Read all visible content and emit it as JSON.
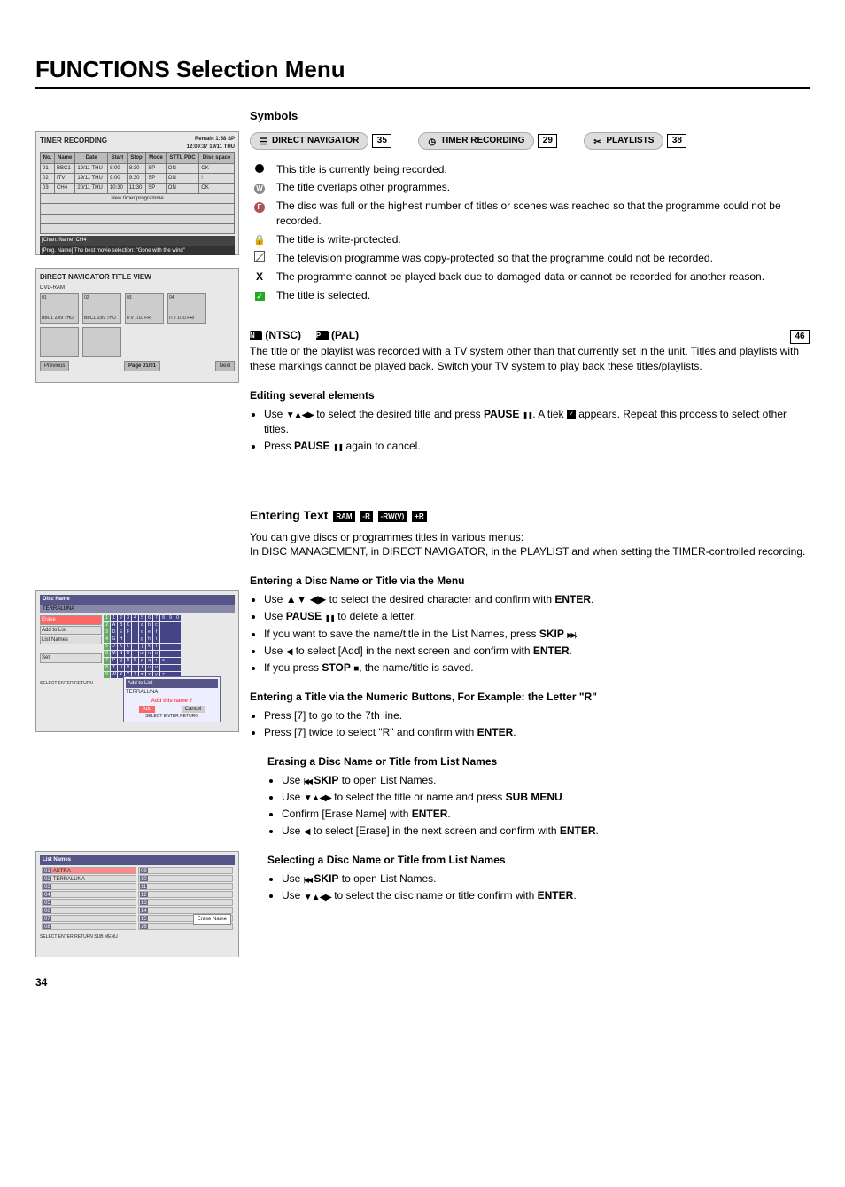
{
  "page": {
    "title": "FUNCTIONS Selection Menu",
    "number": "34"
  },
  "nav": {
    "symbols_heading": "Symbols",
    "items": [
      {
        "label": "DIRECT NAVIGATOR",
        "page": "35"
      },
      {
        "label": "TIMER RECORDING",
        "page": "29"
      },
      {
        "label": "PLAYLISTS",
        "page": "38"
      }
    ]
  },
  "symbols": [
    {
      "text": "This title is currently being recorded."
    },
    {
      "text": "The title overlaps other programmes."
    },
    {
      "text": "The disc was full or the highest number of titles or scenes was reached so that the programme could not be recorded."
    },
    {
      "text": "The title is write-protected."
    },
    {
      "text": "The television programme was copy-protected so that the programme could not be recorded."
    },
    {
      "text": "The programme cannot be played back due to damaged data or cannot be recorded for another reason.",
      "prefix": "X"
    },
    {
      "text": "The title is selected."
    }
  ],
  "ntsc_pal": {
    "ntsc": "(NTSC)",
    "pal": "(PAL)",
    "page": "46",
    "body": "The title or the playlist was recorded with a TV system other than that currently set in the unit. Titles and playlists with these markings cannot be played back. Switch your TV system to play back these titles/playlists."
  },
  "editing": {
    "heading": "Editing several elements",
    "b1a": "Use ",
    "b1b": " to select the desired title and press ",
    "b1c": "PAUSE",
    "b1d": ". A tiek ",
    "b1e": " appears. Repeat this process to select other titles.",
    "b2a": "Press ",
    "b2b": "PAUSE",
    "b2c": " again to cancel."
  },
  "entering": {
    "heading": "Entering Text",
    "badges": [
      "RAM",
      "-R",
      "-RW(V)",
      "+R"
    ],
    "intro1": "You can give discs or programmes titles in various menus:",
    "intro2": "In DISC MANAGEMENT, in DIRECT NAVIGATOR, in the PLAYLIST and when setting the TIMER-controlled recording."
  },
  "via_menu": {
    "heading": "Entering a Disc Name or Title via the Menu",
    "l1a": "Use ",
    "l1b": " to select the desired character and confirm with ",
    "l1c": "ENTER",
    "l1d": ".",
    "l2a": "Use ",
    "l2b": "PAUSE",
    "l2c": " to delete a letter.",
    "l3a": "If you want to save the name/title in the List Names, press ",
    "l3b": "SKIP",
    "l3c": ".",
    "l4a": "Use ",
    "l4b": " to select [Add] in the next screen and confirm with ",
    "l4c": "ENTER",
    "l4d": ".",
    "l5a": "If you press ",
    "l5b": "STOP",
    "l5c": ", the name/title is saved."
  },
  "via_numeric": {
    "heading": "Entering a Title via the Numeric Buttons, For Example: the Letter \"R\"",
    "l1": "Press [7] to go to the 7th line.",
    "l2a": "Press [7] twice to select \"R\" and confirm with ",
    "l2b": "ENTER",
    "l2c": "."
  },
  "erasing": {
    "heading": "Erasing a Disc Name or Title from List Names",
    "l1a": "Use ",
    "l1b": "SKIP",
    "l1c": " to open List Names.",
    "l2a": "Use ",
    "l2b": " to select the title or name and press ",
    "l2c": "SUB MENU",
    "l2d": ".",
    "l3a": "Confirm [Erase Name] with ",
    "l3b": "ENTER",
    "l3c": ".",
    "l4a": "Use ",
    "l4b": " to select [Erase] in the next screen and confirm with ",
    "l4c": "ENTER",
    "l4d": "."
  },
  "selecting": {
    "heading": "Selecting a Disc Name or Title from List Names",
    "l1a": "Use ",
    "l1b": "SKIP",
    "l1c": " to open List Names.",
    "l2a": "Use ",
    "l2b": " to select the disc name or title confirm with ",
    "l2c": "ENTER",
    "l2d": "."
  },
  "shots": {
    "timer": {
      "title": "TIMER RECORDING",
      "remain": "Remain   1:58 SP",
      "date": "12:09:37    19/11  THU",
      "cols": [
        "No.",
        "Name",
        "Date",
        "Start",
        "Stop",
        "Mode",
        "STTL PDC",
        "Disc space"
      ],
      "rows": [
        [
          "01",
          "BBC1",
          "19/11 THU",
          "8:00",
          "8:30",
          "SP",
          "ON",
          "OK"
        ],
        [
          "02",
          "ITV",
          "19/11 THU",
          "9:00",
          "9:30",
          "SP",
          "ON",
          "!"
        ],
        [
          "03",
          "CH4",
          "20/11 THU",
          "10:30",
          "11:30",
          "SP",
          "ON",
          "OK"
        ]
      ],
      "new": "New timer programme",
      "chan": "[Chan. Name] CH4",
      "prog": "[Prog. Name] The best movie selection: \"Gone with the wind\""
    },
    "titleview": {
      "head": "DIRECT NAVIGATOR  TITLE VIEW",
      "disc": "DVD-RAM",
      "cells": [
        {
          "n": "01",
          "t": "BBC1  23/9 THU"
        },
        {
          "n": "02",
          "t": "BBC1  23/9 THU"
        },
        {
          "n": "03",
          "t": "ITV  1/10 FRI"
        },
        {
          "n": "04",
          "t": "ITV  1/10 FRI"
        }
      ],
      "prev": "Previous",
      "page": "Page 01/01",
      "next": "Next"
    },
    "discname": {
      "head": "Disc Name",
      "val": "TERRALUNA",
      "left": [
        "Erase",
        "Add to List",
        "List Names",
        "Set"
      ],
      "popup_head": "Add to List",
      "popup_val": "TERRALUNA",
      "popup_q": "Add this name ?",
      "popup_add": "Add",
      "popup_cancel": "Cancel",
      "foot": "SELECT   ENTER   RETURN"
    },
    "listnames": {
      "head": "List Names",
      "r1": "01  ASTRA",
      "r2": "02  TERRALUNA",
      "popup": "Erase Name",
      "foot": "SELECT  ENTER  RETURN  SUB MENU"
    }
  }
}
